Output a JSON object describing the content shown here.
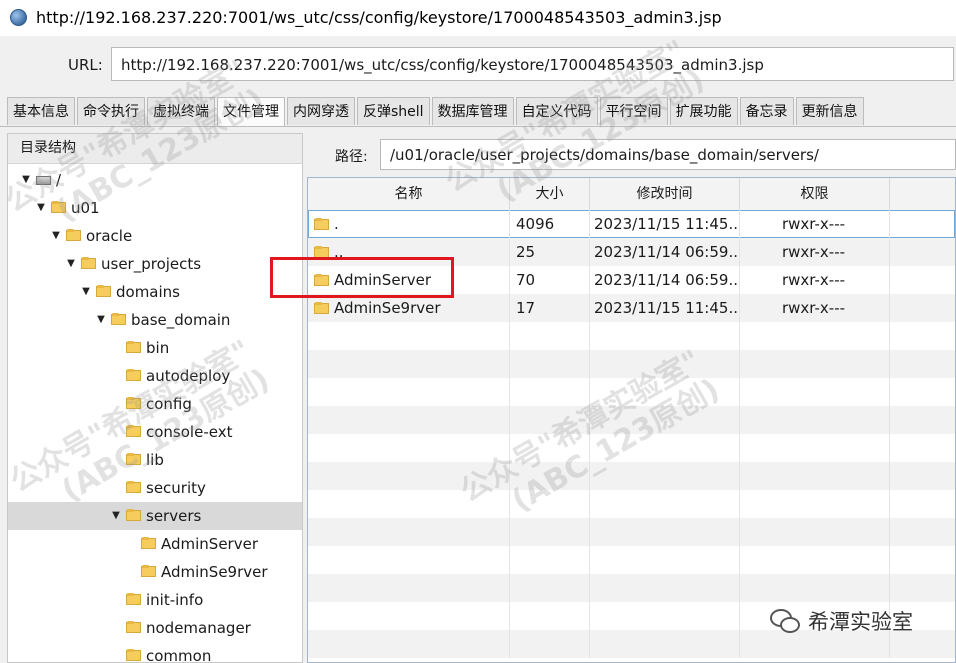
{
  "window": {
    "title": "http://192.168.237.220:7001/ws_utc/css/config/keystore/1700048543503_admin3.jsp"
  },
  "urlbar": {
    "label": "URL:",
    "value": "http://192.168.237.220:7001/ws_utc/css/config/keystore/1700048543503_admin3.jsp"
  },
  "tabs": [
    {
      "label": "基本信息"
    },
    {
      "label": "命令执行"
    },
    {
      "label": "虚拟终端"
    },
    {
      "label": "文件管理"
    },
    {
      "label": "内网穿透"
    },
    {
      "label": "反弹shell"
    },
    {
      "label": "数据库管理"
    },
    {
      "label": "自定义代码"
    },
    {
      "label": "平行空间"
    },
    {
      "label": "扩展功能"
    },
    {
      "label": "备忘录"
    },
    {
      "label": "更新信息"
    }
  ],
  "tree": {
    "header": "目录结构",
    "nodes": [
      {
        "label": "/",
        "icon": "drive-icon",
        "expanded": true
      },
      {
        "label": "u01",
        "icon": "folder-icon",
        "expanded": true
      },
      {
        "label": "oracle",
        "icon": "folder-icon",
        "expanded": true
      },
      {
        "label": "user_projects",
        "icon": "folder-icon",
        "expanded": true
      },
      {
        "label": "domains",
        "icon": "folder-icon",
        "expanded": true
      },
      {
        "label": "base_domain",
        "icon": "folder-icon",
        "expanded": true
      },
      {
        "label": "bin",
        "icon": "folder-icon"
      },
      {
        "label": "autodeploy",
        "icon": "folder-icon"
      },
      {
        "label": "config",
        "icon": "folder-icon"
      },
      {
        "label": "console-ext",
        "icon": "folder-icon"
      },
      {
        "label": "lib",
        "icon": "folder-icon"
      },
      {
        "label": "security",
        "icon": "folder-icon"
      },
      {
        "label": "servers",
        "icon": "folder-icon",
        "expanded": true,
        "selected": true
      },
      {
        "label": "AdminServer",
        "icon": "folder-icon"
      },
      {
        "label": "AdminSe9rver",
        "icon": "folder-icon"
      },
      {
        "label": "init-info",
        "icon": "folder-icon"
      },
      {
        "label": "nodemanager",
        "icon": "folder-icon"
      },
      {
        "label": "common",
        "icon": "folder-icon"
      }
    ]
  },
  "path": {
    "label": "路径:",
    "value": "/u01/oracle/user_projects/domains/base_domain/servers/"
  },
  "files": {
    "columns": [
      "名称",
      "大小",
      "修改时间",
      "权限"
    ],
    "rows": [
      {
        "name": ".",
        "size": "4096",
        "mtime": "2023/11/15 11:45...",
        "perm": "rwxr-x---"
      },
      {
        "name": "..",
        "size": "25",
        "mtime": "2023/11/14 06:59...",
        "perm": "rwxr-x---"
      },
      {
        "name": "AdminServer",
        "size": "70",
        "mtime": "2023/11/14 06:59...",
        "perm": "rwxr-x---"
      },
      {
        "name": "AdminSe9rver",
        "size": "17",
        "mtime": "2023/11/15 11:45...",
        "perm": "rwxr-x---"
      }
    ]
  },
  "watermarks": {
    "line1": "公众号\"希潭实验室\"",
    "line2": "(ABC_123原创)",
    "badge": "希潭实验室"
  },
  "colors": {
    "highlight": "#e0171d",
    "selection": "#d9d9d9",
    "folder": "#f6cd5d"
  }
}
